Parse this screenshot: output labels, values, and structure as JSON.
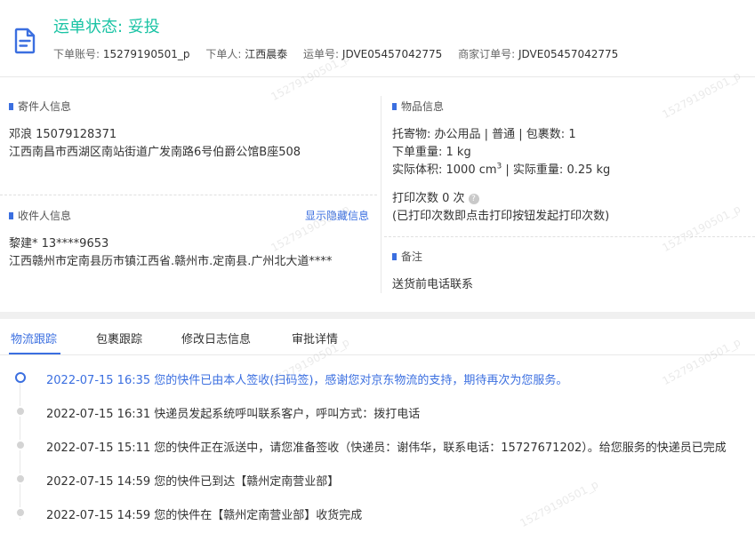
{
  "header": {
    "status_label": "运单状态:",
    "status_value": "妥投",
    "meta": [
      {
        "key": "下单账号:",
        "value": "15279190501_p"
      },
      {
        "key": "下单人:",
        "value": "江西晨泰"
      },
      {
        "key": "运单号:",
        "value": "JDVE05457042775"
      },
      {
        "key": "商家订单号:",
        "value": "JDVE05457042775"
      }
    ]
  },
  "sender": {
    "title": "寄件人信息",
    "name_phone": "邓浪   15079128371",
    "address": "江西南昌市西湖区南站街道广发南路6号伯爵公馆B座508"
  },
  "receiver": {
    "title": "收件人信息",
    "toggle_link": "显示隐藏信息",
    "name_phone": "黎建*   13****9653",
    "address": "江西赣州市定南县历市镇江西省.赣州市.定南县.广州北大道****"
  },
  "goods": {
    "title": "物品信息",
    "line1": "托寄物: 办公用品 | 普通 | 包裹数: 1",
    "line2": "下单重量:  1 kg",
    "volume_label": "实际体积:   1000 cm",
    "volume_sup": "3",
    "weight_label": " | 实际重量:  0.25 kg",
    "print_count": "打印次数   0 次",
    "print_note": "(已打印次数即点击打印按钮发起打印次数)"
  },
  "remark": {
    "title": "备注",
    "text": "送货前电话联系"
  },
  "tabs": [
    {
      "label": "物流跟踪",
      "active": true
    },
    {
      "label": "包裹跟踪",
      "active": false
    },
    {
      "label": "修改日志信息",
      "active": false
    },
    {
      "label": "审批详情",
      "active": false
    }
  ],
  "timeline": [
    {
      "text": "2022-07-15 16:35 您的快件已由本人签收(扫码签)，感谢您对京东物流的支持，期待再次为您服务。",
      "active": true
    },
    {
      "text": "2022-07-15 16:31 快递员发起系统呼叫联系客户，呼叫方式：拨打电话",
      "active": false
    },
    {
      "text": "2022-07-15 15:11 您的快件正在派送中，请您准备签收（快递员：谢伟华，联系电话：15727671202）。给您服务的快递员已完成",
      "active": false
    },
    {
      "text": "2022-07-15 14:59 您的快件已到达【赣州定南营业部】",
      "active": false
    },
    {
      "text": "2022-07-15 14:59 您的快件在【赣州定南营业部】收货完成",
      "active": false
    }
  ],
  "watermark": "15279190501_p",
  "colors": {
    "accent": "#3b6fe0",
    "status": "#19c3a4"
  }
}
